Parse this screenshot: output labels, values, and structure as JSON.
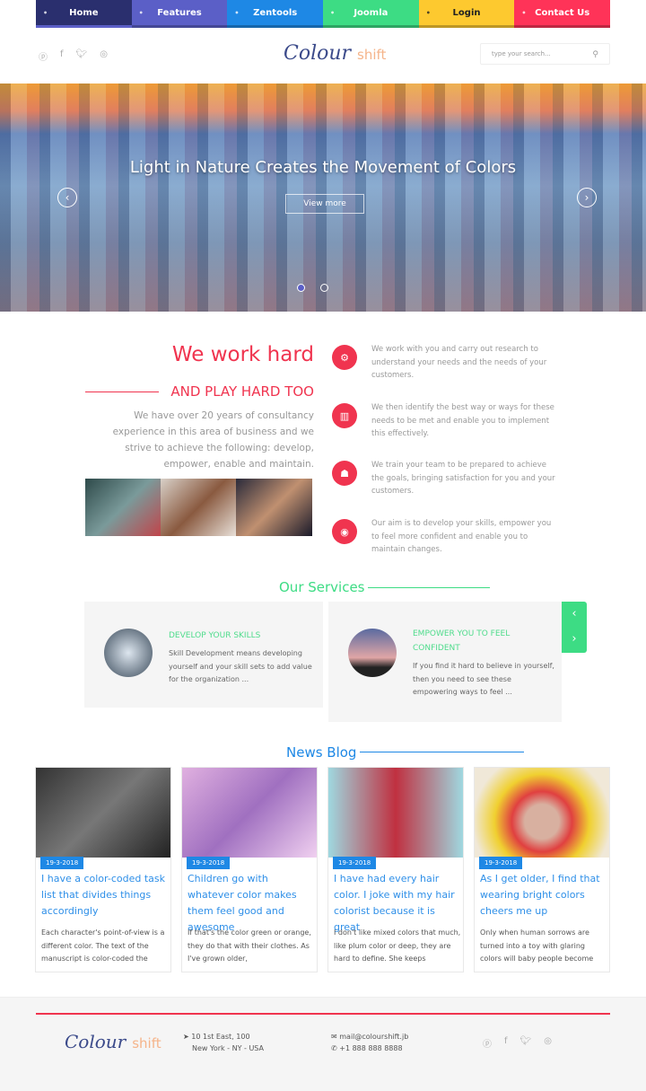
{
  "nav": [
    {
      "label": "Home",
      "color": "#2a2f6e"
    },
    {
      "label": "Features",
      "color": "#5b5fc7"
    },
    {
      "label": "Zentools",
      "color": "#1e88e5"
    },
    {
      "label": "Joomla",
      "color": "#3ddc84"
    },
    {
      "label": "Login",
      "color": "#fdc92f"
    },
    {
      "label": "Contact Us",
      "color": "#ff3358"
    }
  ],
  "header": {
    "logo_main": "Colour",
    "logo_accent": "shift",
    "search_placeholder": "type your search...",
    "social": [
      "pinterest-icon",
      "facebook-icon",
      "twitter-icon",
      "dribbble-icon"
    ]
  },
  "hero": {
    "title": "Light in Nature Creates the Movement of Colors",
    "button": "View more"
  },
  "about": {
    "heading": "We work hard",
    "subheading": "AND PLAY HARD TOO",
    "text": "We have over 20 years of consultancy experience in this area of business and we strive to achieve the following: develop, empower, enable and maintain.",
    "features": [
      {
        "icon": "gears-icon",
        "text": "We work with you and carry out research to understand your needs and the needs of your customers."
      },
      {
        "icon": "bar-chart-icon",
        "text": "We then identify the best way or ways for these needs to be met and enable you to implement this effectively."
      },
      {
        "icon": "team-icon",
        "text": "We train your team to be prepared to achieve the goals, bringing satisfaction for you and your customers."
      },
      {
        "icon": "target-icon",
        "text": "Our aim is to develop your skills, empower you to feel more confident and enable you to maintain changes."
      }
    ]
  },
  "services": {
    "title": "Our Services",
    "items": [
      {
        "title": "DEVELOP YOUR SKILLS",
        "text": "Skill Development means developing yourself and your skill sets to add value for the organization ..."
      },
      {
        "title": "EMPOWER YOU TO FEEL CONFIDENT",
        "text": "If you find it hard to believe in yourself, then you need to see these empowering ways to feel ..."
      }
    ]
  },
  "blog": {
    "title": "News Blog",
    "posts": [
      {
        "date": "19-3-2018",
        "title": "I have a color-coded task list that divides things accordingly",
        "excerpt": "Each character's point-of-view is a different color. The text of the manuscript is color-coded the"
      },
      {
        "date": "19-3-2018",
        "title": "Children go with whatever color makes them feel good and awesome",
        "excerpt": "If that's the color green or orange, they do that with their clothes. As I've grown older,"
      },
      {
        "date": "19-3-2018",
        "title": "I have had every hair color. I joke with my hair colorist because it is great",
        "excerpt": "I don't like mixed colors that much, like plum color or deep, they are hard to define. She keeps"
      },
      {
        "date": "19-3-2018",
        "title": "As I get older, I find that wearing bright colors cheers me up",
        "excerpt": "Only when human sorrows are turned into a toy with glaring colors will baby people become"
      }
    ]
  },
  "footer": {
    "address1": "10 1st East, 100",
    "address2": "New York - NY - USA",
    "email": "mail@colourshift.jb",
    "phone": "+1 888 888 8888"
  }
}
